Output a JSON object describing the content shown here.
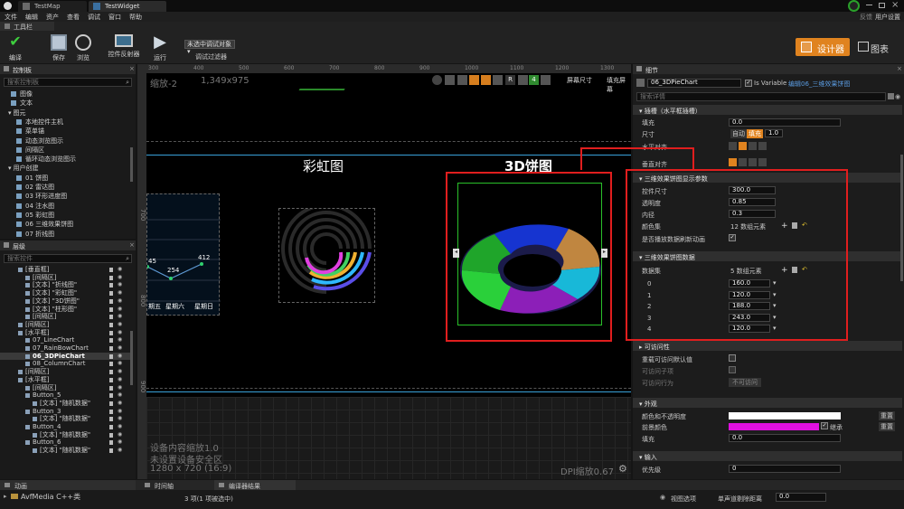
{
  "title_bar": {
    "tabs": [
      "TestMap",
      "TestWidget"
    ]
  },
  "menu": [
    "文件",
    "编辑",
    "资产",
    "查看",
    "调试",
    "窗口",
    "帮助"
  ],
  "top_right": {
    "label1": "反馈",
    "label2": "用户设置"
  },
  "toolbar": {
    "tab": "工具栏",
    "buttons": [
      "编译",
      "保存",
      "浏览",
      "控件反射器",
      "运行"
    ],
    "debug_filter": {
      "value": "未选中调试对象",
      "label": "调试过滤器"
    },
    "designer": "设计器",
    "graph": "图表"
  },
  "palette": {
    "title": "控制板",
    "search_placeholder": "搜索控制板",
    "items": [
      "图像",
      "文本"
    ],
    "sections": [
      {
        "name": "图元",
        "items": [
          "本地控件主机",
          "菜单锚",
          "动态浏览图示",
          "间隔区",
          "循环动态浏览图示"
        ]
      },
      {
        "name": "用户创建",
        "items": [
          "01 饼图",
          "02 雷达图",
          "03 环形进度图",
          "04 注水图",
          "05 彩虹图",
          "06 三维效果饼图",
          "07 折线图"
        ]
      }
    ]
  },
  "hierarchy": {
    "title": "层级",
    "search_placeholder": "搜索控件",
    "rows": [
      {
        "depth": 1,
        "text": "[垂直框]",
        "sel": false
      },
      {
        "depth": 2,
        "text": "[间隔区]",
        "sel": false
      },
      {
        "depth": 2,
        "text": "[文本] \"折线图\"",
        "sel": false
      },
      {
        "depth": 2,
        "text": "[文本] \"彩虹图\"",
        "sel": false
      },
      {
        "depth": 2,
        "text": "[文本] \"3D饼图\"",
        "sel": false
      },
      {
        "depth": 2,
        "text": "[文本] \"柱形图\"",
        "sel": false
      },
      {
        "depth": 2,
        "text": "[间隔区]",
        "sel": false
      },
      {
        "depth": 1,
        "text": "[间隔区]",
        "sel": false
      },
      {
        "depth": 1,
        "text": "[水平框]",
        "sel": false
      },
      {
        "depth": 2,
        "text": "07_LineChart",
        "sel": false
      },
      {
        "depth": 2,
        "text": "07_RainBowChart",
        "sel": false
      },
      {
        "depth": 2,
        "text": "06_3DPieChart",
        "sel": true
      },
      {
        "depth": 2,
        "text": "08_ColumnChart",
        "sel": false
      },
      {
        "depth": 1,
        "text": "[间隔区]",
        "sel": false
      },
      {
        "depth": 1,
        "text": "[水平框]",
        "sel": false
      },
      {
        "depth": 2,
        "text": "[间隔区]",
        "sel": false
      },
      {
        "depth": 2,
        "text": "Button_5",
        "sel": false
      },
      {
        "depth": 3,
        "text": "[文本] \"随机数据\"",
        "sel": false
      },
      {
        "depth": 2,
        "text": "Button_3",
        "sel": false
      },
      {
        "depth": 3,
        "text": "[文本] \"随机数据\"",
        "sel": false
      },
      {
        "depth": 2,
        "text": "Button_4",
        "sel": false
      },
      {
        "depth": 3,
        "text": "[文本] \"随机数据\"",
        "sel": false
      },
      {
        "depth": 2,
        "text": "Button_6",
        "sel": false
      },
      {
        "depth": 3,
        "text": "[文本] \"随机数据\"",
        "sel": false
      }
    ]
  },
  "viewport": {
    "zoom": "缩放-2",
    "size_readout": "1,349x975",
    "ruler_labels": [
      "300",
      "400",
      "500",
      "600",
      "700",
      "800",
      "900",
      "1000",
      "1100",
      "1200",
      "1300"
    ],
    "side_ruler": [
      "700",
      "800",
      "900"
    ],
    "screen_size": "屏幕尺寸",
    "fill_screen": "填充屏幕",
    "grid_num": "4",
    "rainbow_title": "彩虹图",
    "pie_title": "3D饼图",
    "line_values": [
      "45",
      "254",
      "412"
    ],
    "weekdays": [
      "期五",
      "星期六",
      "星期日"
    ],
    "bottom_info": [
      "设备内容缩放1.0",
      "未设置设备安全区",
      "1280 x 720 (16:9)"
    ],
    "dpi": "DPI缩放0.67",
    "r_btn": "R"
  },
  "details": {
    "title": "细节",
    "widget_name": "06_3DPieChart",
    "is_variable": "Is Variable",
    "edit_link": "编辑06_三维效果饼图",
    "search_placeholder": "搜索详情",
    "slot": {
      "head": "插槽（水平框插槽）",
      "padding_label": "填充",
      "padding_value": "0.0",
      "size_label": "尺寸",
      "size_auto": "自动",
      "size_fill": "填充",
      "size_value": "1.0",
      "halign_label": "水平对齐",
      "valign_label": "垂直对齐"
    },
    "display": {
      "head": "三维效果饼图显示参数",
      "rows": [
        {
          "label": "控件尺寸",
          "value": "300.0"
        },
        {
          "label": "透明度",
          "value": "0.85"
        },
        {
          "label": "内径",
          "value": "0.3"
        }
      ],
      "colorset_label": "颜色集",
      "colorset_value": "12 数组元素",
      "refresh_label": "是否播放数据刷新动画"
    },
    "data": {
      "head": "三维效果饼图数据",
      "label": "数据集",
      "count": "5 数组元素",
      "items": [
        {
          "index": "0",
          "value": "160.0"
        },
        {
          "index": "1",
          "value": "120.0"
        },
        {
          "index": "2",
          "value": "188.0"
        },
        {
          "index": "3",
          "value": "243.0"
        },
        {
          "index": "4",
          "value": "120.0"
        }
      ]
    },
    "access": {
      "head": "可访问性",
      "rows": [
        "重载可访问默认值",
        "可访问子项",
        "可访问行为"
      ],
      "behavior_value": "不可访问"
    },
    "appearance": {
      "head": "外观",
      "color_opacity": "颜色和不透明度",
      "fg_color": "前景颜色",
      "inherit": "继承",
      "padding": "填充",
      "padding_value": "0.0",
      "reset": "重置"
    },
    "input": {
      "head": "输入",
      "priority": "优先级",
      "priority_value": "0"
    },
    "colors": {
      "fg": "#e010e0",
      "white": "#ffffff"
    }
  },
  "bottom": {
    "tabs": [
      "动画",
      "时间轴",
      "编译器结果"
    ],
    "anim_item": "AvfMedia C++类",
    "status": "3 项(1 项被选中)",
    "view_options": "视图选项",
    "distance_label": "单声道剔除距离",
    "distance_value": "0.0"
  }
}
